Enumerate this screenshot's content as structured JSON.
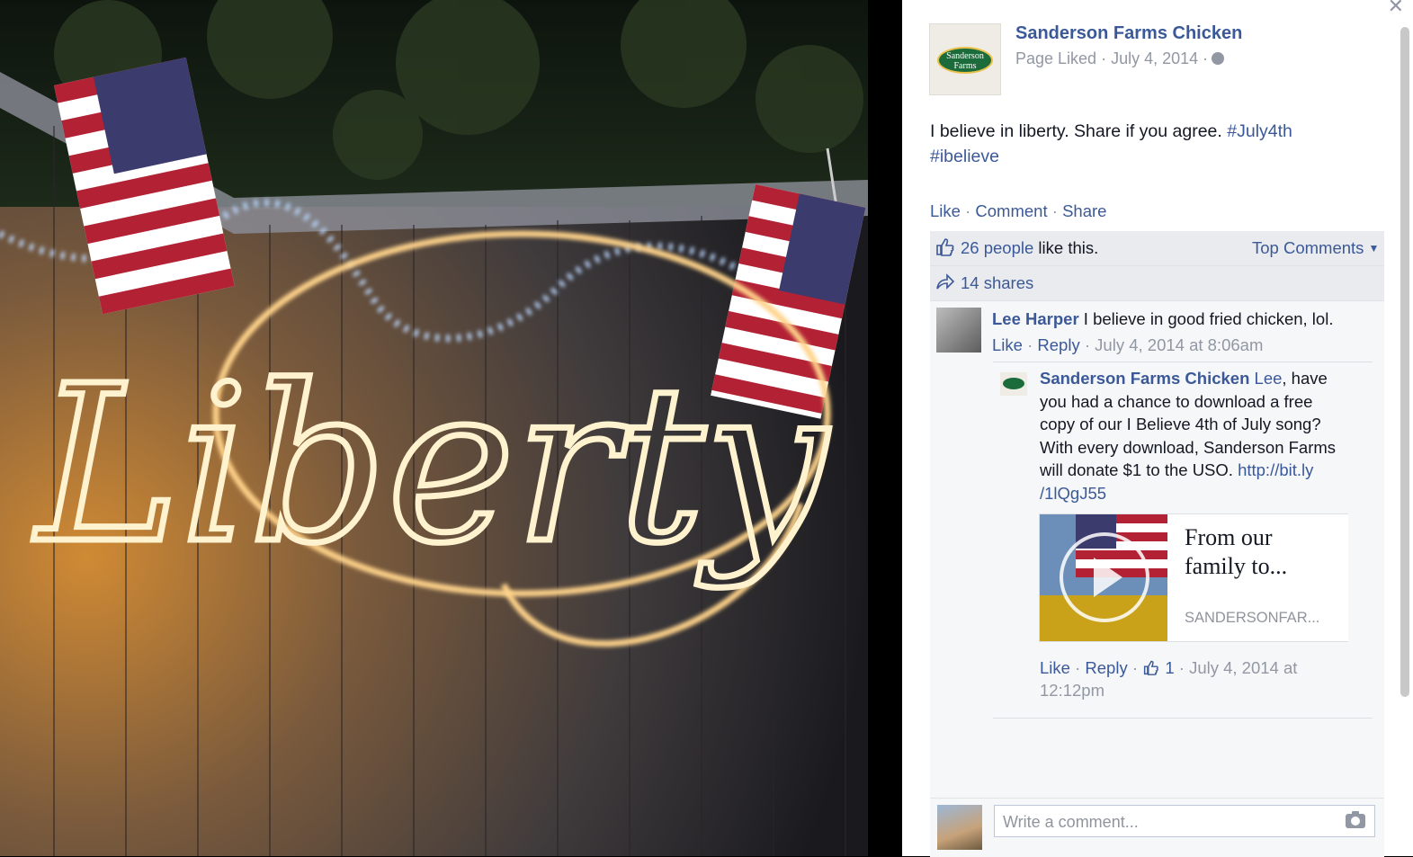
{
  "photo": {
    "sparkler_text": "Liberty"
  },
  "post": {
    "page_name": "Sanderson Farms Chicken",
    "logo_text_line1": "Sanderson",
    "logo_text_line2": "Farms",
    "meta": "Page Liked · July 4, 2014 ·",
    "text": "I believe in liberty. Share if you agree.",
    "hashtags": [
      "#July4th",
      "#ibelieve"
    ],
    "actions": {
      "like": "Like",
      "comment": "Comment",
      "share": "Share",
      "sep": " · "
    }
  },
  "ufi": {
    "likes_count": "26 people",
    "likes_suffix": " like this.",
    "top_comments": "Top Comments",
    "shares": "14 shares"
  },
  "comments": [
    {
      "author": "Lee Harper",
      "text": "I believe in good fried chicken, lol.",
      "like": "Like",
      "reply": "Reply",
      "time": "July 4, 2014 at 8:06am"
    }
  ],
  "reply": {
    "author": "Sanderson Farms Chicken",
    "mention": "Lee",
    "text_after_mention": ", have you had a chance to download a free copy of our I Believe 4th of July song? With every download, Sanderson Farms will donate $1 to the USO.",
    "link": "http://bit.ly/1lQgJ55",
    "link_line1": "http://bit.ly",
    "link_line2": "/1lQgJ55",
    "card_title": "From our family to...",
    "card_domain": "SANDERSONFAR...",
    "like": "Like",
    "reply": "Reply",
    "like_count": "1",
    "time_line1": "July 4, 2014 at",
    "time_line2": "12:12pm"
  },
  "composer": {
    "placeholder": "Write a comment..."
  },
  "colors": {
    "link": "#3b5998",
    "meta": "#9197a3",
    "text": "#141823",
    "ufi_bg": "#f6f7f9"
  },
  "icons": [
    "close-icon",
    "globe-icon",
    "like-thumb-icon",
    "share-arrow-icon",
    "play-icon",
    "camera-icon",
    "dropdown-caret-icon"
  ]
}
